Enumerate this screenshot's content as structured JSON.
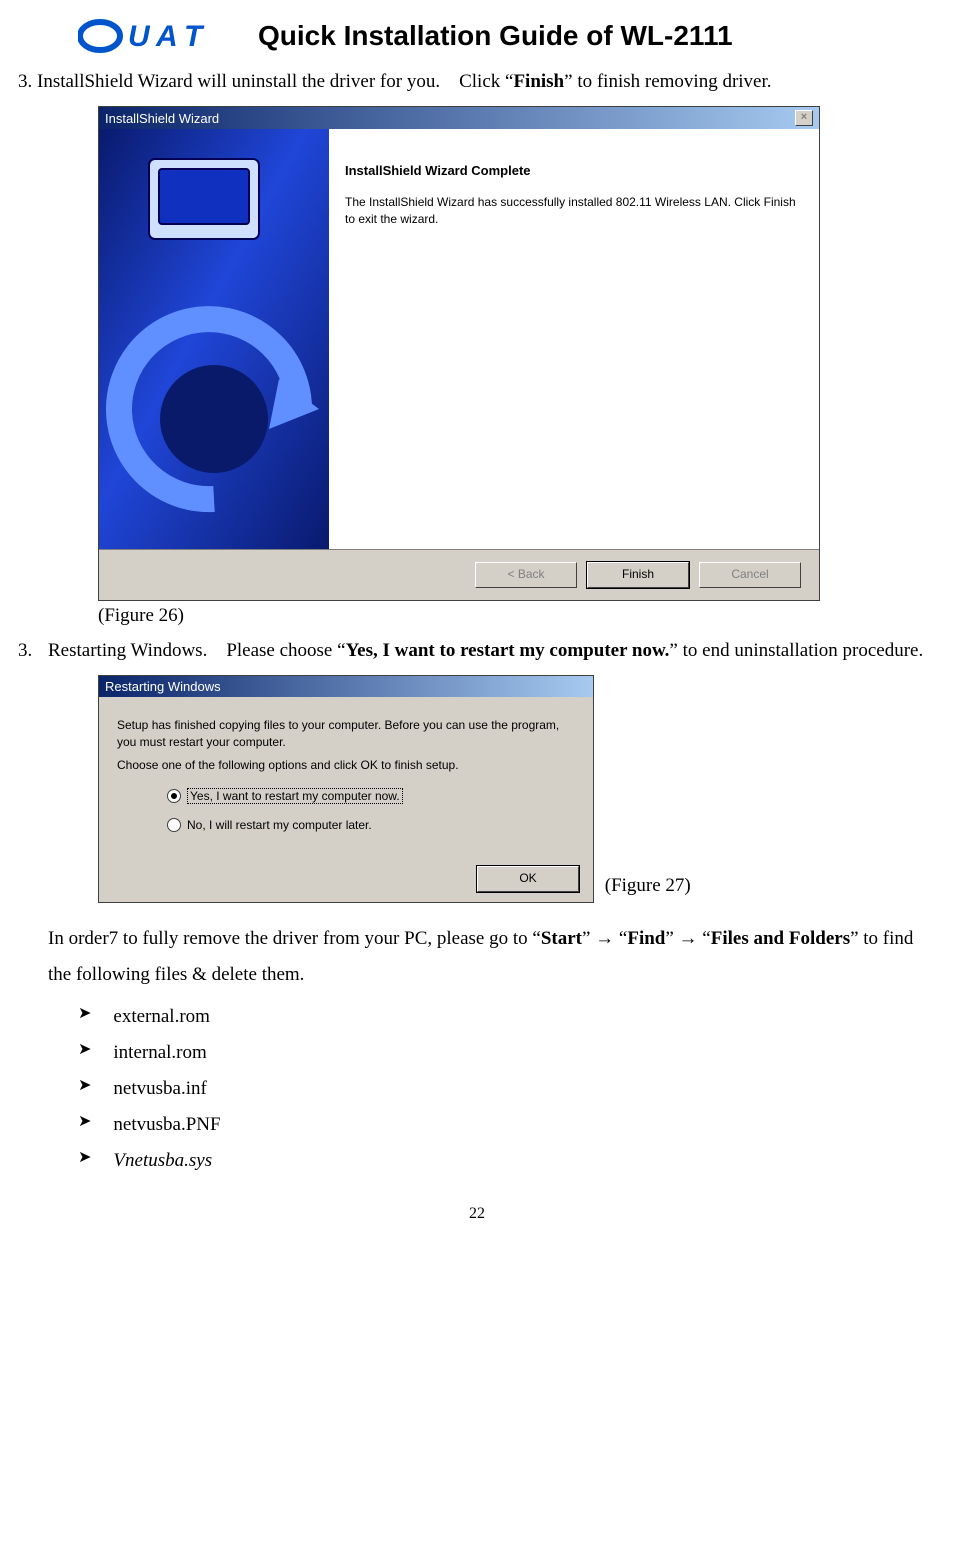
{
  "header": {
    "logo_text_1": "U",
    "logo_text_2": "A",
    "logo_text_3": "T",
    "title": "Quick Installation Guide of WL-2111"
  },
  "step3_top": {
    "prefix": "3. InstallShield Wizard will uninstall the driver for you.    Click “",
    "bold": "Finish",
    "suffix": "” to finish removing driver."
  },
  "wizard1": {
    "titlebar": "InstallShield Wizard",
    "heading": "InstallShield Wizard Complete",
    "body": "The InstallShield Wizard has successfully installed 802.11 Wireless LAN.  Click Finish to exit the wizard.",
    "back": "< Back",
    "finish": "Finish",
    "cancel": "Cancel"
  },
  "caption1": "(Figure 26)",
  "step3_restart": {
    "num": "3.",
    "prefix": "Restarting Windows.    Please choose “",
    "bold": "Yes, I want to restart my computer now.",
    "suffix": "” to end uninstallation procedure."
  },
  "wizard2": {
    "titlebar": "Restarting Windows",
    "p1": "Setup has finished copying files to your computer.  Before you can use the program, you must restart your computer.",
    "p2": "Choose one of the following options and click OK to finish setup.",
    "opt1": "Yes, I want to restart my computer now.",
    "opt2": "No, I will restart my computer later.",
    "ok": "OK"
  },
  "caption2": "(Figure 27)",
  "removal_para": {
    "prefix": "In order7 to fully remove the driver from your PC, please go to “",
    "b1": "Start",
    "arrow1": "” → “",
    "b2": "Find",
    "arrow2": "” → “",
    "b3": "Files and Folders",
    "suffix": "” to find the following files & delete them."
  },
  "files": [
    "external.rom",
    "internal.rom",
    "netvusba.inf",
    "netvusba.PNF"
  ],
  "file_italic": "Vnetusba.sys",
  "bullet_glyph": "➤",
  "page_number": "22"
}
